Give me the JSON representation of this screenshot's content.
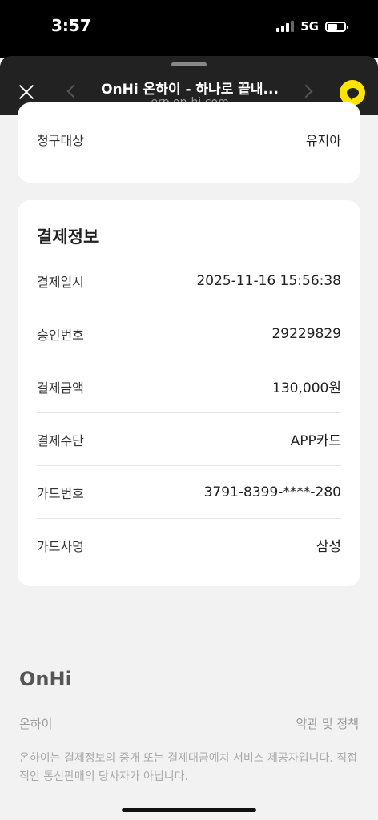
{
  "status_bar": {
    "time": "3:57",
    "network": "5G"
  },
  "header": {
    "title": "OnHi 온하이 - 하나로 끝내...",
    "url": "erp.on-hi.com"
  },
  "billing": {
    "label": "청구대상",
    "value": "유지아"
  },
  "payment": {
    "title": "결제정보",
    "rows": [
      {
        "label": "결제일시",
        "value": "2025-11-16 15:56:38"
      },
      {
        "label": "승인번호",
        "value": "29229829"
      },
      {
        "label": "결제금액",
        "value": "130,000원"
      },
      {
        "label": "결제수단",
        "value": "APP카드"
      },
      {
        "label": "카드번호",
        "value": "3791-8399-****-280"
      },
      {
        "label": "카드사명",
        "value": "삼성"
      }
    ]
  },
  "footer": {
    "logo": "OnHi",
    "company": "온하이",
    "terms_link": "약관 및 정책",
    "notice": "온하이는 결제정보의 중개 또는 결제대금예치 서비스 제공자입니다. 직접적인 통신판매의 당사자가 아닙니다."
  },
  "colors": {
    "kakao": "#fee500",
    "header_bg": "#222222",
    "page_bg": "#f2f2f2"
  },
  "icons": [
    "close-icon",
    "back-arrow-icon",
    "forward-arrow-icon",
    "kakao-talk-icon",
    "signal-icon",
    "battery-icon"
  ]
}
